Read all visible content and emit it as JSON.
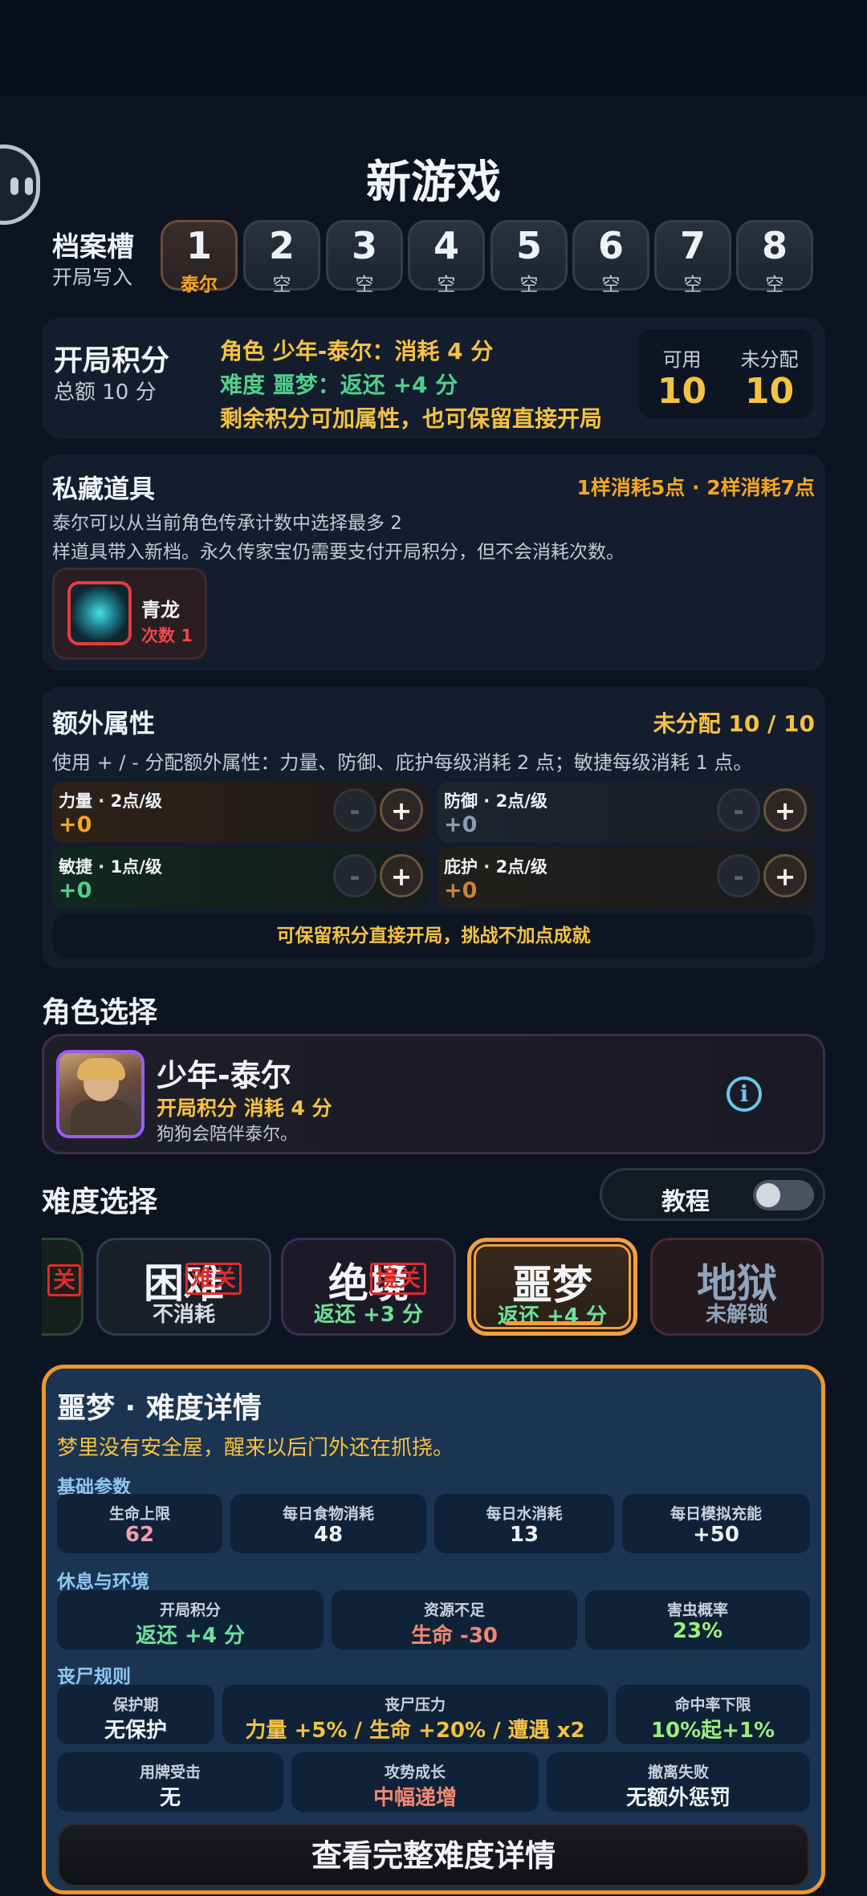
{
  "title": "新游戏",
  "slots": {
    "label": "档案槽",
    "sublabel": "开局写入",
    "items": [
      {
        "num": "1",
        "sub": "泰尔"
      },
      {
        "num": "2",
        "sub": "空"
      },
      {
        "num": "3",
        "sub": "空"
      },
      {
        "num": "4",
        "sub": "空"
      },
      {
        "num": "5",
        "sub": "空"
      },
      {
        "num": "6",
        "sub": "空"
      },
      {
        "num": "7",
        "sub": "空"
      },
      {
        "num": "8",
        "sub": "空"
      }
    ]
  },
  "points": {
    "title": "开局积分",
    "total": "总额 10 分",
    "line1": "角色 少年-泰尔：消耗 4 分",
    "line2": "难度 噩梦：返还 +4 分",
    "line3": "剩余积分可加属性，也可保留直接开局",
    "available_label": "可用",
    "available_value": "10",
    "unassigned_label": "未分配",
    "unassigned_value": "10"
  },
  "items": {
    "title": "私藏道具",
    "cost": "1样消耗5点 · 2样消耗7点",
    "desc1": "泰尔可以从当前角色传承计数中选择最多 2",
    "desc2": "样道具带入新档。永久传家宝仍需要支付开局积分，但不会消耗次数。",
    "card": {
      "name": "青龙",
      "count": "次数 1"
    }
  },
  "attrs": {
    "title": "额外属性",
    "unassigned": "未分配 10 / 10",
    "desc": "使用 + / - 分配额外属性：力量、防御、庇护每级消耗 2 点；敏捷每级消耗 1 点。",
    "list": [
      {
        "name": "力量 · 2点/级",
        "value": "+0",
        "color": "#f5a623"
      },
      {
        "name": "防御 · 2点/级",
        "value": "+0",
        "color": "#8a9cb0"
      },
      {
        "name": "敏捷 · 1点/级",
        "value": "+0",
        "color": "#4fd08b"
      },
      {
        "name": "庇护 · 2点/级",
        "value": "+0",
        "color": "#c8853a"
      }
    ],
    "minus": "-",
    "plus": "+",
    "tip": "可保留积分直接开局，挑战不加点成就"
  },
  "character": {
    "section": "角色选择",
    "name": "少年-泰尔",
    "cost": "开局积分 消耗 4 分",
    "desc": "狗狗会陪伴泰尔。",
    "info": "i"
  },
  "difficulty": {
    "section": "难度选择",
    "tutorial": "教程",
    "stamp": "关",
    "cards": [
      {
        "name": "困难",
        "sub": "不消耗",
        "stamp": "难关"
      },
      {
        "name": "绝境",
        "sub": "返还 +3 分",
        "stamp": "境关"
      },
      {
        "name": "噩梦",
        "sub": "返还 +4 分"
      },
      {
        "name": "地狱",
        "sub": "未解锁"
      }
    ]
  },
  "detail": {
    "title": "噩梦 · 难度详情",
    "desc": "梦里没有安全屋，醒来以后门外还在抓挠。",
    "sec1": "基础参数",
    "row1": [
      {
        "k": "生命上限",
        "v": "62"
      },
      {
        "k": "每日食物消耗",
        "v": "48"
      },
      {
        "k": "每日水消耗",
        "v": "13"
      },
      {
        "k": "每日模拟充能",
        "v": "+50"
      }
    ],
    "sec2": "休息与环境",
    "row2": [
      {
        "k": "开局积分",
        "v": "返还 +4 分"
      },
      {
        "k": "资源不足",
        "v": "生命 -30"
      },
      {
        "k": "害虫概率",
        "v": "23%"
      }
    ],
    "sec3": "丧尸规则",
    "row3": [
      {
        "k": "保护期",
        "v": "无保护"
      },
      {
        "k": "丧尸压力",
        "v": "力量 +5% / 生命 +20% / 遭遇 x2"
      },
      {
        "k": "命中率下限",
        "v": "10%起+1%"
      }
    ],
    "row4": [
      {
        "k": "用牌受击",
        "v": "无"
      },
      {
        "k": "攻势成长",
        "v": "中幅递增"
      },
      {
        "k": "撤离失败",
        "v": "无额外惩罚"
      }
    ],
    "button": "查看完整难度详情"
  }
}
